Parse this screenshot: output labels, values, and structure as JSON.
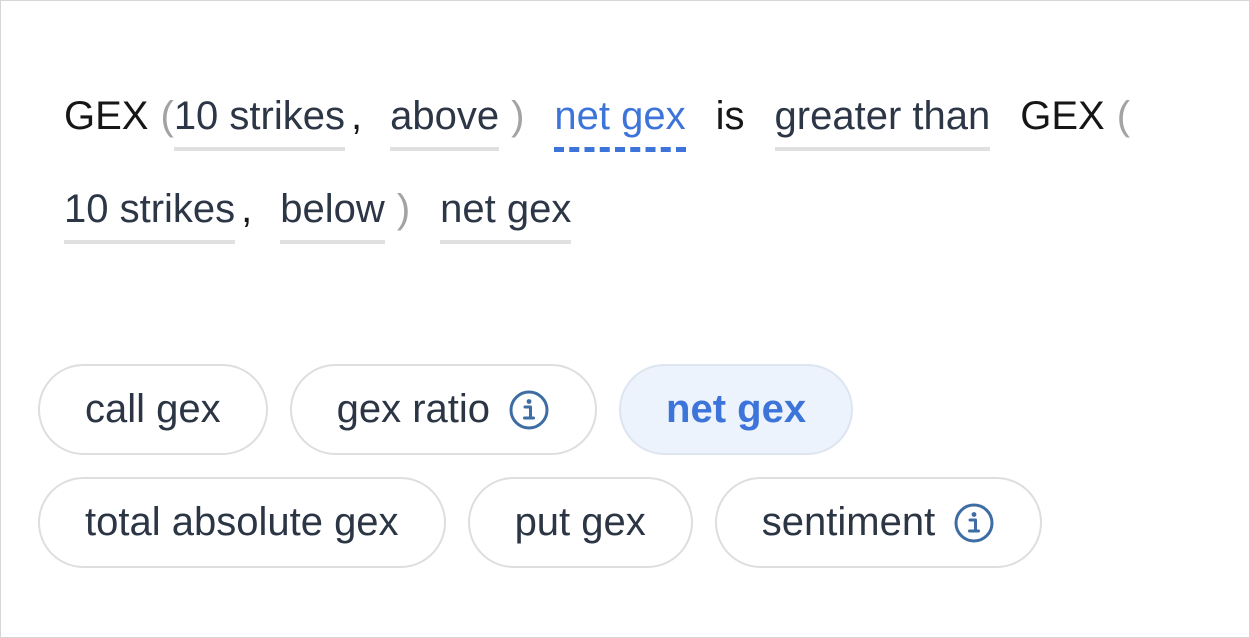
{
  "expression": {
    "function_name_1": "GEX",
    "open_paren": "(",
    "close_paren": ")",
    "comma": ",",
    "strikes_1": "10 strikes",
    "direction_1": "above",
    "metric_1": "net gex",
    "is_word": "is",
    "comparator": "greater than",
    "function_name_2": "GEX",
    "strikes_2": "10 strikes",
    "direction_2": "below",
    "metric_2": "net gex"
  },
  "options": [
    {
      "label": "call gex",
      "info": false,
      "selected": false
    },
    {
      "label": "gex ratio",
      "info": true,
      "selected": false
    },
    {
      "label": "net gex",
      "info": false,
      "selected": true
    },
    {
      "label": "total absolute gex",
      "info": false,
      "selected": false
    },
    {
      "label": "put gex",
      "info": false,
      "selected": false
    },
    {
      "label": "sentiment",
      "info": true,
      "selected": false
    }
  ],
  "colors": {
    "accent": "#3d74da",
    "selected_chip_bg": "#edf3fc",
    "underline": "#e0e0e0",
    "text": "#2b3544"
  },
  "icons": {
    "info": "info-circle-icon"
  }
}
